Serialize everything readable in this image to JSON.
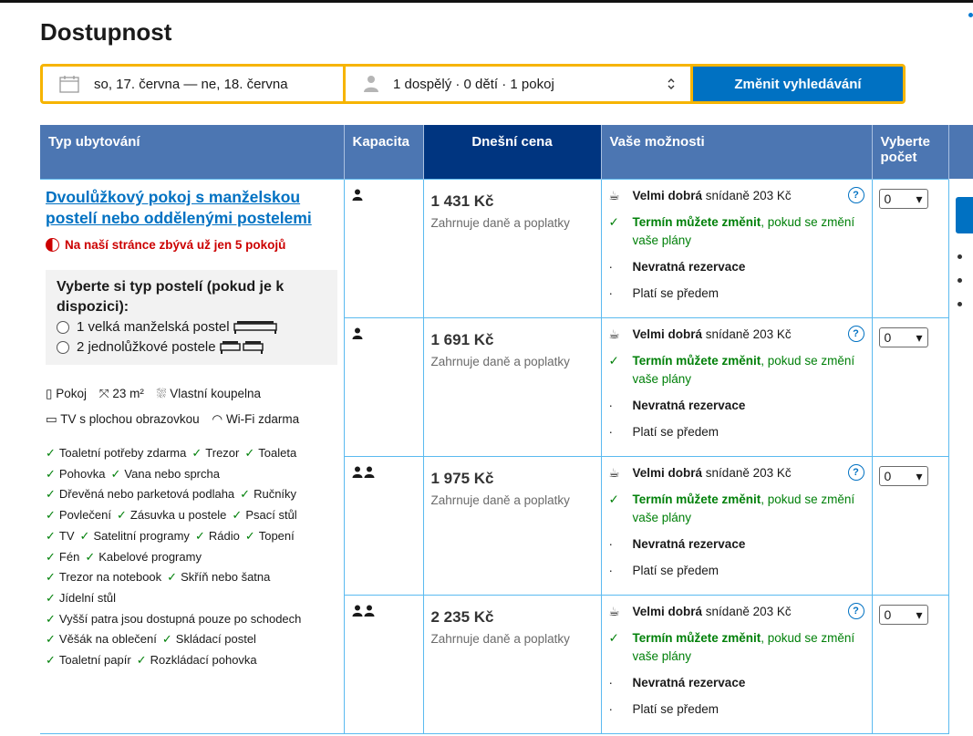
{
  "page": {
    "title": "Dostupnost"
  },
  "search": {
    "dates": "so, 17. června — ne, 18. června",
    "occupancy": "1 dospělý · 0 dětí · 1 pokoj",
    "button": "Změnit vyhledávání"
  },
  "table": {
    "headers": {
      "type": "Typ ubytování",
      "capacity": "Kapacita",
      "price": "Dnešní cena",
      "options": "Vaše možnosti",
      "select": "Vyberte počet"
    },
    "room": {
      "name": "Dvoulůžkový pokoj s manželskou postelí nebo oddělenými postelemi",
      "availability": "Na naší stránce zbývá už jen 5 pokojů",
      "bed_question": "Vyberte si typ postelí (pokud je k dispozici):",
      "bed_options": [
        "1 velká manželská postel",
        "2 jednolůžkové postele"
      ],
      "facilities": [
        "Pokoj",
        "23 m²",
        "Vlastní koupelna",
        "TV s plochou obrazovkou",
        "Wi-Fi zdarma"
      ],
      "amenities": [
        [
          "Toaletní potřeby zdarma",
          "Trezor",
          "Toaleta"
        ],
        [
          "Pohovka",
          "Vana nebo sprcha"
        ],
        [
          "Dřevěná nebo parketová podlaha",
          "Ručníky"
        ],
        [
          "Povlečení",
          "Zásuvka u postele",
          "Psací stůl"
        ],
        [
          "TV",
          "Satelitní programy",
          "Rádio",
          "Topení"
        ],
        [
          "Fén",
          "Kabelové programy"
        ],
        [
          "Trezor na notebook",
          "Skříň nebo šatna"
        ],
        [
          "Jídelní stůl"
        ],
        [
          "Vyšší patra jsou dostupná pouze po schodech"
        ],
        [
          "Věšák na oblečení",
          "Skládací postel"
        ],
        [
          "Toaletní papír",
          "Rozkládací pohovka"
        ]
      ]
    },
    "rows": [
      {
        "persons": 1,
        "price": "1 431 Kč",
        "price_note": "Zahrnuje daně a poplatky",
        "qty": "0"
      },
      {
        "persons": 1,
        "price": "1 691 Kč",
        "price_note": "Zahrnuje daně a poplatky",
        "qty": "0"
      },
      {
        "persons": 2,
        "price": "1 975 Kč",
        "price_note": "Zahrnuje daně a poplatky",
        "qty": "0"
      },
      {
        "persons": 2,
        "price": "2 235 Kč",
        "price_note": "Zahrnuje daně a poplatky",
        "qty": "0"
      }
    ],
    "options": {
      "breakfast_strong": "Velmi dobrá",
      "breakfast_rest": "snídaně 203 Kč",
      "change_strong": "Termín můžete změnit",
      "change_rest": ", pokud se změní vaše plány",
      "nonrefundable": "Nevratná rezervace",
      "prepay": "Platí se předem",
      "help": "?"
    }
  },
  "colors": {
    "accent": "#0071c2",
    "header_bg": "#4c76b2",
    "price_header_bg": "#003580",
    "highlight": "#f6b400",
    "success": "#008009",
    "urgent": "#cc0000"
  }
}
